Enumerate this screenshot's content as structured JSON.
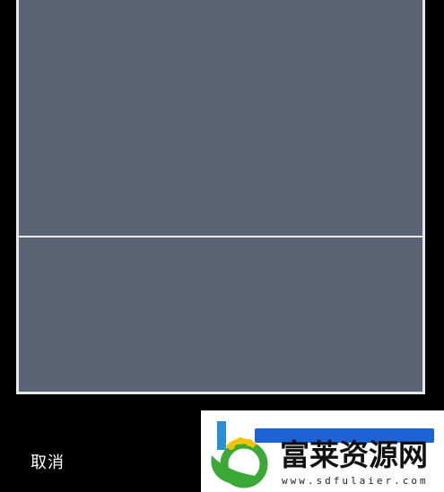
{
  "actions": {
    "cancel_label": "取消"
  },
  "watermark": {
    "title": "富莱资源网",
    "url": "www.sdfulaier.com"
  },
  "colors": {
    "background": "#000000",
    "frame_fill": "#5b6474",
    "frame_border": "#e7e8ea",
    "watermark_blue": "#1e63d6",
    "watermark_green": "#3aa935",
    "watermark_yellow": "#f2c200"
  },
  "icons": [
    "leaf-logo-icon"
  ]
}
